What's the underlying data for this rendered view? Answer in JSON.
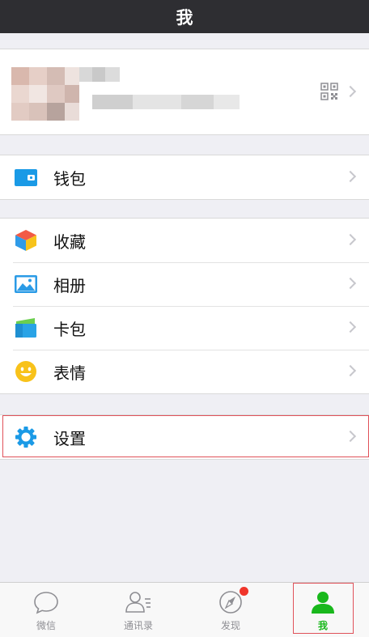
{
  "header": {
    "title": "我"
  },
  "profile": {
    "blurred": true,
    "qr_icon": "qr-code-icon"
  },
  "menu": {
    "wallet": {
      "label": "钱包",
      "icon": "wallet-icon"
    },
    "collections": {
      "label": "收藏",
      "icon": "favorites-cube-icon"
    },
    "album": {
      "label": "相册",
      "icon": "photo-album-icon"
    },
    "cards": {
      "label": "卡包",
      "icon": "card-wallet-icon"
    },
    "stickers": {
      "label": "表情",
      "icon": "smiley-icon"
    },
    "settings": {
      "label": "设置",
      "icon": "gear-icon"
    }
  },
  "tabbar": {
    "tabs": [
      {
        "label": "微信",
        "icon": "chat-bubble-icon",
        "active": false
      },
      {
        "label": "通讯录",
        "icon": "contacts-icon",
        "active": false
      },
      {
        "label": "发现",
        "icon": "compass-icon",
        "active": false,
        "badge": true
      },
      {
        "label": "我",
        "icon": "person-icon",
        "active": true
      }
    ]
  },
  "colors": {
    "navbar": "#2e2e32",
    "background": "#efeff4",
    "accent_green": "#19b81c",
    "highlight_red": "#e0525a",
    "badge_red": "#f0352b"
  }
}
